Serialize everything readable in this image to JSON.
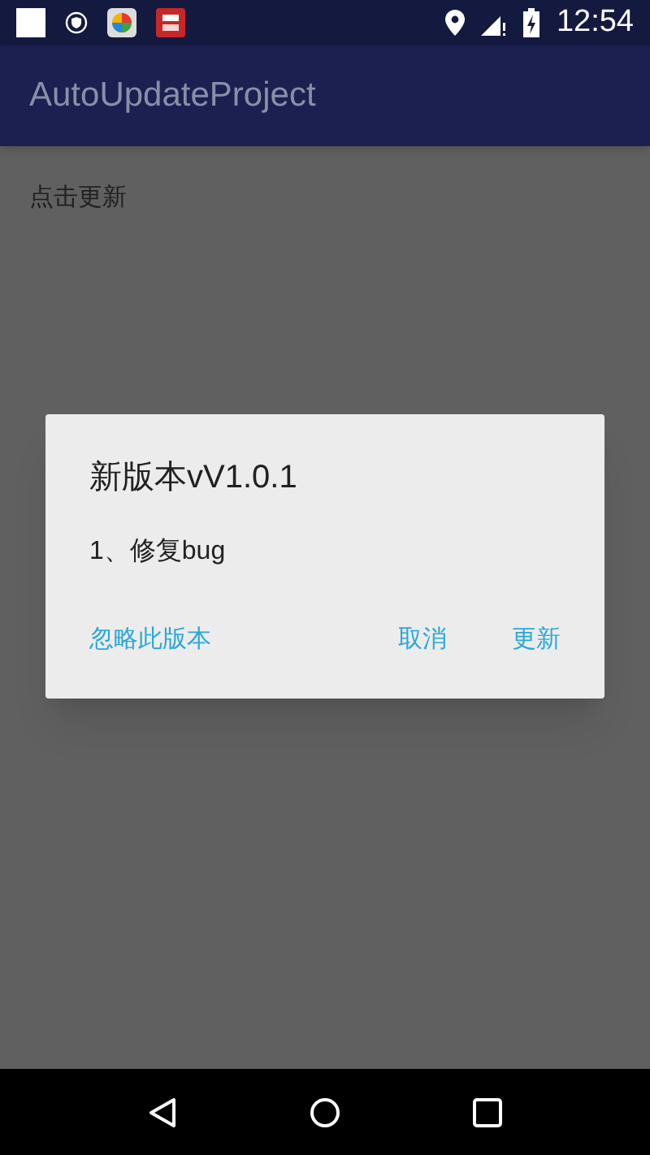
{
  "status_bar": {
    "time": "12:54"
  },
  "app_bar": {
    "title": "AutoUpdateProject"
  },
  "content": {
    "text": "点击更新"
  },
  "dialog": {
    "title": "新版本vV1.0.1",
    "message": "1、修复bug",
    "buttons": [
      {
        "label": "忽略此版本"
      },
      {
        "label": "取消"
      },
      {
        "label": "更新"
      }
    ]
  }
}
